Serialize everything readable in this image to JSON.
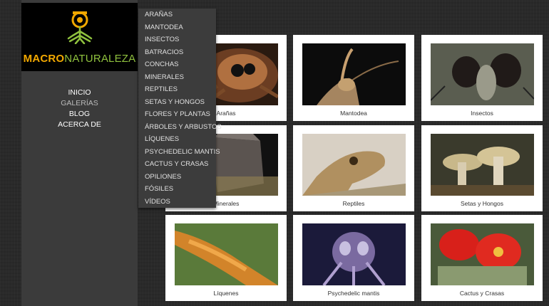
{
  "logo": {
    "part1": "MACRO",
    "part2": "NATURALEZA"
  },
  "nav": [
    "INICIO",
    "GALERÍAS",
    "BLOG",
    "ACERCA DE"
  ],
  "dropdown": [
    "ARAÑAS",
    "MANTODEA",
    "INSECTOS",
    "BATRACIOS",
    "CONCHAS",
    "MINERALES",
    "REPTILES",
    "SETAS Y HONGOS",
    "FLORES Y PLANTAS",
    "ÁRBOLES Y ARBUSTOS",
    "LÍQUENES",
    "PSYCHEDELIC MANTIS",
    "CACTUS Y CRASAS",
    "OPILIONES",
    "FÓSILES",
    "VÍDEOS"
  ],
  "gallery": [
    {
      "caption": "Arañas"
    },
    {
      "caption": "Mantodea"
    },
    {
      "caption": "Insectos"
    },
    {
      "caption": "Minerales"
    },
    {
      "caption": "Reptiles"
    },
    {
      "caption": "Setas y Hongos"
    },
    {
      "caption": "Líquenes"
    },
    {
      "caption": "Psychedelic mantis"
    },
    {
      "caption": "Cactus y Crasas"
    }
  ],
  "colors": {
    "accent_orange": "#f2a800",
    "accent_green": "#8fc13e",
    "sidebar": "#3b3b3b"
  }
}
